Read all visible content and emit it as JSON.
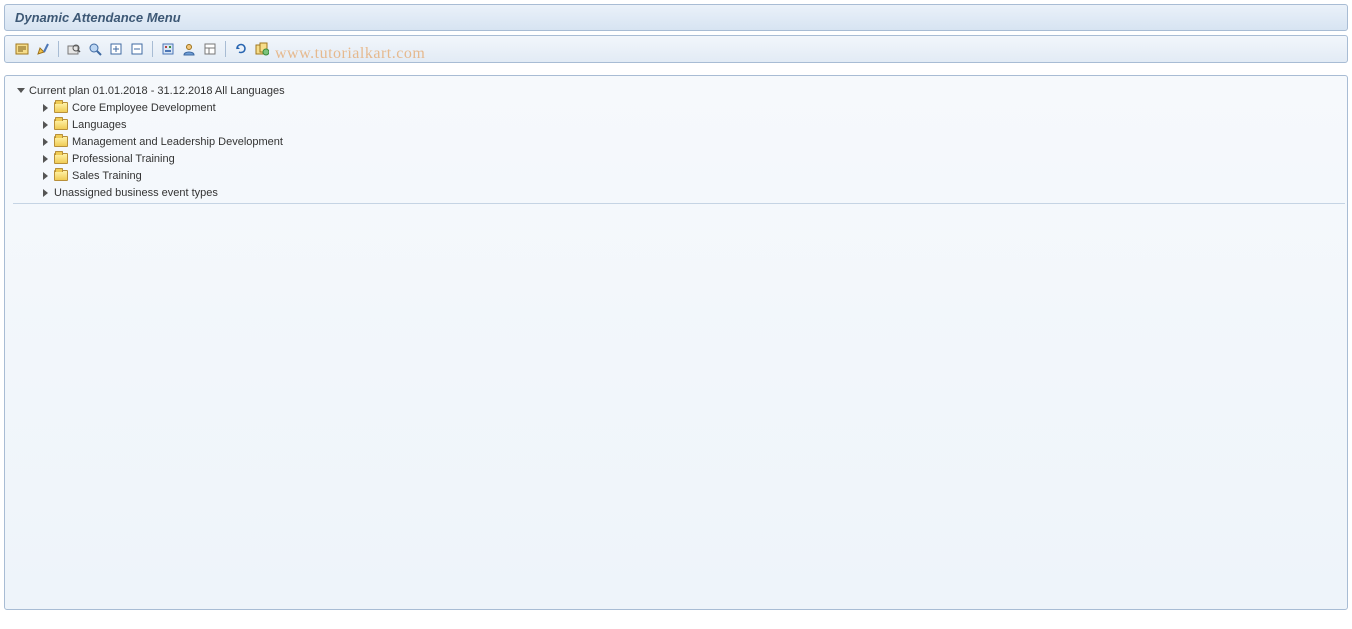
{
  "header": {
    "title": "Dynamic Attendance Menu"
  },
  "toolbar": {
    "icons": [
      "pick-list-icon",
      "change-icon",
      "find-icon",
      "find-again-icon",
      "expand-icon",
      "collapse-icon",
      "detail-icon",
      "user-icon",
      "layout-icon",
      "refresh-icon",
      "mass-book-icon"
    ]
  },
  "watermark": "www.tutorialkart.com",
  "tree": {
    "root_label": "Current plan 01.01.2018 - 31.12.2018 All Languages",
    "children": [
      {
        "label": "Core Employee Development",
        "has_folder": true
      },
      {
        "label": "Languages",
        "has_folder": true
      },
      {
        "label": "Management and Leadership Development",
        "has_folder": true
      },
      {
        "label": "Professional Training",
        "has_folder": true
      },
      {
        "label": "Sales Training",
        "has_folder": true
      },
      {
        "label": "Unassigned business event types",
        "has_folder": false
      }
    ]
  }
}
